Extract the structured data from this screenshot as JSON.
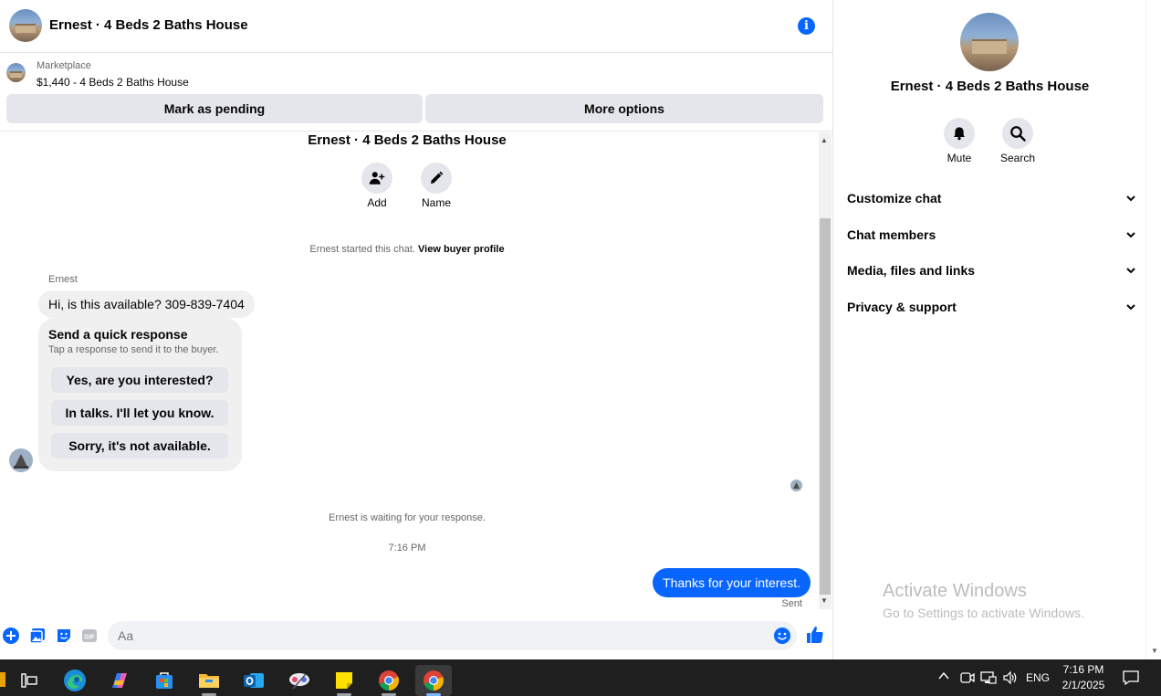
{
  "header": {
    "title": "Ernest · 4 Beds 2 Baths House"
  },
  "listing": {
    "source": "Marketplace",
    "title": "$1,440 - 4 Beds 2 Baths House",
    "mark_pending": "Mark as pending",
    "more_options": "More options"
  },
  "thread": {
    "title": "Ernest · 4 Beds 2 Baths House",
    "add_label": "Add",
    "name_label": "Name",
    "started_text": "Ernest started this chat.",
    "view_profile": "View buyer profile",
    "sender_name": "Ernest",
    "incoming_message": "Hi, is this available? 309-839-7404",
    "quick_title": "Send a quick response",
    "quick_sub": "Tap a response to send it to the buyer.",
    "quick_options": [
      "Yes, are you interested?",
      "In talks. I'll let you know.",
      "Sorry, it's not available."
    ],
    "waiting_text": "Ernest is waiting for your response.",
    "time": "7:16 PM",
    "outgoing_message": "Thanks for your interest.",
    "sent_label": "Sent"
  },
  "composer": {
    "placeholder": "Aa"
  },
  "side_panel": {
    "title": "Ernest · 4 Beds 2 Baths House",
    "mute_label": "Mute",
    "search_label": "Search",
    "rows": [
      "Customize chat",
      "Chat members",
      "Media, files and links",
      "Privacy & support"
    ]
  },
  "watermark": {
    "title": "Activate Windows",
    "subtitle": "Go to Settings to activate Windows."
  },
  "taskbar": {
    "language": "ENG",
    "time": "7:16 PM",
    "date": "2/1/2025",
    "icons": [
      "task-view-icon",
      "edge-icon",
      "copilot-icon",
      "store-icon",
      "file-explorer-icon",
      "outlook-icon",
      "snipping-tool-icon",
      "sticky-notes-icon",
      "chrome-icon",
      "chrome-active-icon"
    ]
  },
  "colors": {
    "accent": "#0866ff",
    "bubble_gray": "#f0f0f0",
    "button_gray": "#e4e6eb"
  }
}
